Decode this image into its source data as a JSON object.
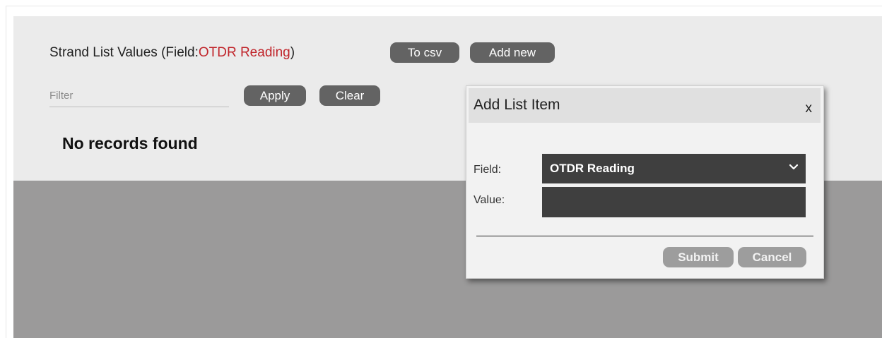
{
  "header": {
    "title_prefix": "Strand List Values (Field: ",
    "field_name": "OTDR Reading",
    "title_suffix": ")",
    "to_csv_label": "To csv",
    "add_new_label": "Add new"
  },
  "filter": {
    "placeholder": "Filter",
    "value": "",
    "apply_label": "Apply",
    "clear_label": "Clear"
  },
  "results": {
    "empty_message": "No records found"
  },
  "dialog": {
    "title": "Add List Item",
    "close_label": "x",
    "field_label": "Field:",
    "field_selected": "OTDR Reading",
    "value_label": "Value:",
    "value": "",
    "submit_label": "Submit",
    "cancel_label": "Cancel"
  },
  "colors": {
    "panel_bg": "#ebebeb",
    "overlay_bg": "#9b9a9a",
    "button_bg": "#636363",
    "accent_text": "#c0242a",
    "dialog_bg": "#f2f2f2",
    "input_dark": "#3f3f3f",
    "disabled_button": "#9d9d9d"
  }
}
